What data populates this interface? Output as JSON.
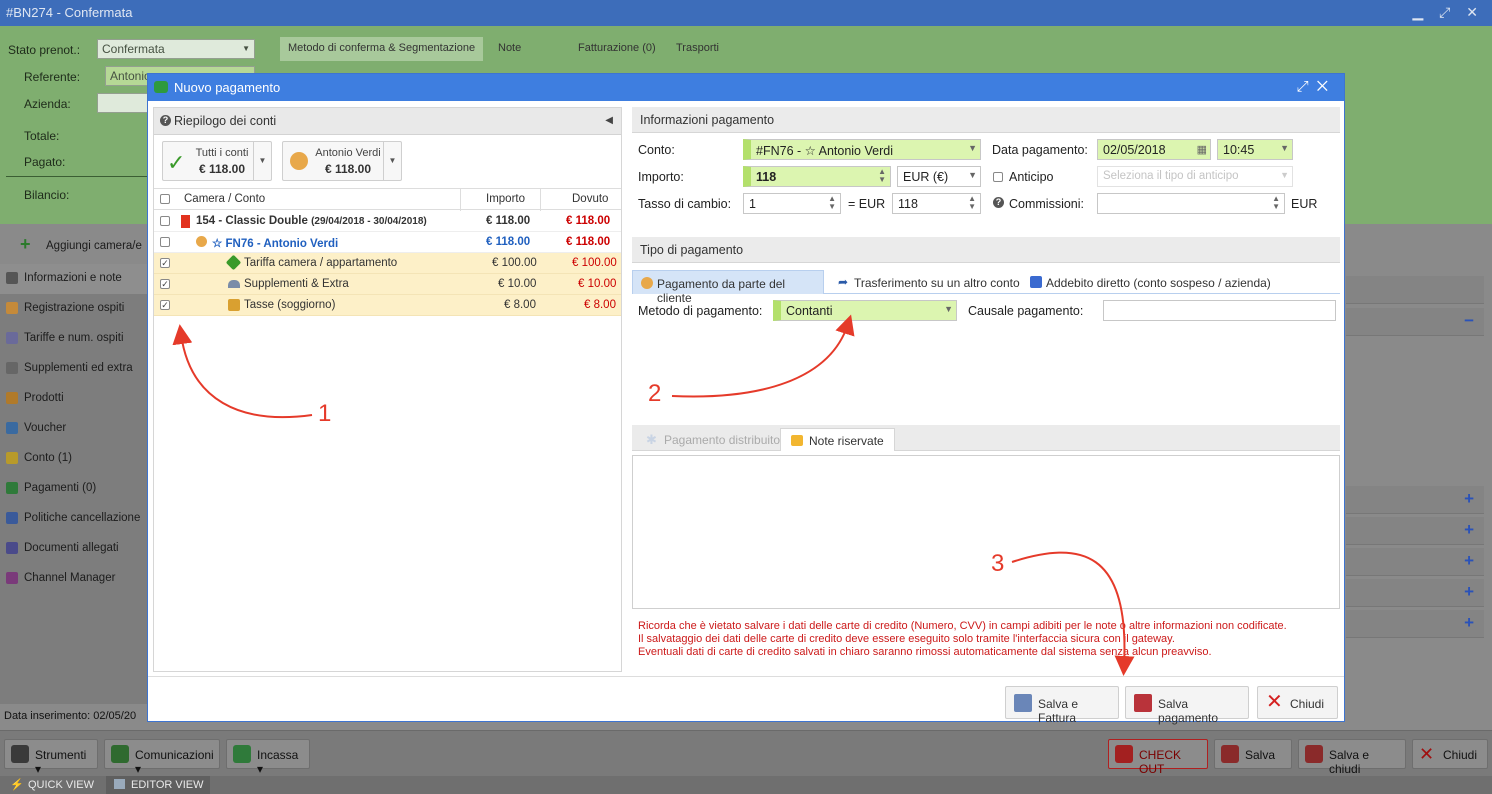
{
  "window": {
    "title": "#BN274 - Confermata"
  },
  "background": {
    "stato_label": "Stato prenot.:",
    "stato_value": "Confermata",
    "referente_label": "Referente:",
    "referente_value": "Antonio",
    "azienda_label": "Azienda:",
    "totale_label": "Totale:",
    "pagato_label": "Pagato:",
    "bilancio_label": "Bilancio:",
    "tabs": [
      "Metodo di conferma & Segmentazione",
      "Note",
      "Fatturazione (0)",
      "Trasporti"
    ],
    "add_room": "Aggiungi camera/e",
    "data_inserimento": "Data inserimento:  02/05/20",
    "nav": [
      "Informazioni e note",
      "Registrazione ospiti",
      "Tariffe e num. ospiti",
      "Supplementi ed extra",
      "Prodotti",
      "Voucher",
      "Conto (1)",
      "Pagamenti (0)",
      "Politiche cancellazione",
      "Documenti allegati",
      "Channel Manager"
    ],
    "bottom": {
      "strumenti": "Strumenti",
      "comunicazioni": "Comunicazioni",
      "incassa": "Incassa",
      "checkout": "CHECK OUT",
      "salva": "Salva",
      "salva_chiudi": "Salva e chiudi",
      "chiudi": "Chiudi"
    },
    "status": {
      "quick": "QUICK VIEW",
      "editor": "EDITOR VIEW"
    }
  },
  "modal": {
    "title": "Nuovo pagamento",
    "left": {
      "header": "Riepilogo dei conti",
      "btn_all_label": "Tutti i conti",
      "btn_all_amount": "€ 118.00",
      "btn_guest_label": "Antonio Verdi",
      "btn_guest_amount": "€ 118.00",
      "columns": [
        "Camera / Conto",
        "Importo",
        "Dovuto"
      ],
      "rows": [
        {
          "label": "154 - Classic Double",
          "dates": "(29/04/2018 - 30/04/2018)",
          "importo": "€ 118.00",
          "dovuto": "€ 118.00"
        },
        {
          "label": "☆ FN76 - Antonio Verdi",
          "importo": "€ 118.00",
          "dovuto": "€ 118.00"
        },
        {
          "label": "Tariffa camera / appartamento",
          "importo": "€ 100.00",
          "dovuto": "€ 100.00"
        },
        {
          "label": "Supplementi & Extra",
          "importo": "€ 10.00",
          "dovuto": "€ 10.00"
        },
        {
          "label": "Tasse (soggiorno)",
          "importo": "€ 8.00",
          "dovuto": "€ 8.00"
        }
      ]
    },
    "info": {
      "header": "Informazioni pagamento",
      "conto_label": "Conto:",
      "conto_value": "#FN76 - ☆ Antonio Verdi",
      "data_label": "Data pagamento:",
      "data_value": "02/05/2018",
      "ora_value": "10:45",
      "importo_label": "Importo:",
      "importo_value": "118",
      "valuta_value": "EUR (€)",
      "anticipo_label": "Anticipo",
      "anticipo_placeholder": "Seleziona il tipo di anticipo",
      "tasso_label": "Tasso di cambio:",
      "tasso_value": "1",
      "eq_eur": "= EUR",
      "tasso_eur_value": "118",
      "commissioni_label": "Commissioni:",
      "commissioni_unit": "EUR"
    },
    "tipo": {
      "header": "Tipo di pagamento",
      "tabs": [
        "Pagamento da parte del cliente",
        "Trasferimento su un altro conto",
        "Addebito diretto (conto sospeso / azienda)"
      ],
      "metodo_label": "Metodo di pagamento:",
      "metodo_value": "Contanti",
      "causale_label": "Causale pagamento:"
    },
    "notes": {
      "tab_dist": "Pagamento distribuito",
      "tab_note": "Note riservate",
      "warning": [
        "Ricorda che è vietato salvare i dati delle carte di credito (Numero, CVV) in campi adibiti per le note o altre informazioni non codificate.",
        "Il salvataggio dei dati delle carte di credito deve essere eseguito solo tramite l'interfaccia sicura con il gateway.",
        "Eventuali dati di carte di credito salvati in chiaro saranno rimossi automaticamente dal sistema senza alcun preavviso."
      ]
    },
    "footer": {
      "salva_fattura": "Salva e Fattura",
      "salva_pagamento": "Salva pagamento",
      "chiudi": "Chiudi"
    }
  },
  "annotations": [
    "1",
    "2",
    "3"
  ],
  "colors": {
    "titlebar": "#3d6dba",
    "modal_header": "#3e7ee0",
    "accent_green": "#dcf5b0",
    "due_red": "#cc0000",
    "account_blue": "#1f5fbf",
    "annotation": "#e53a2a"
  }
}
